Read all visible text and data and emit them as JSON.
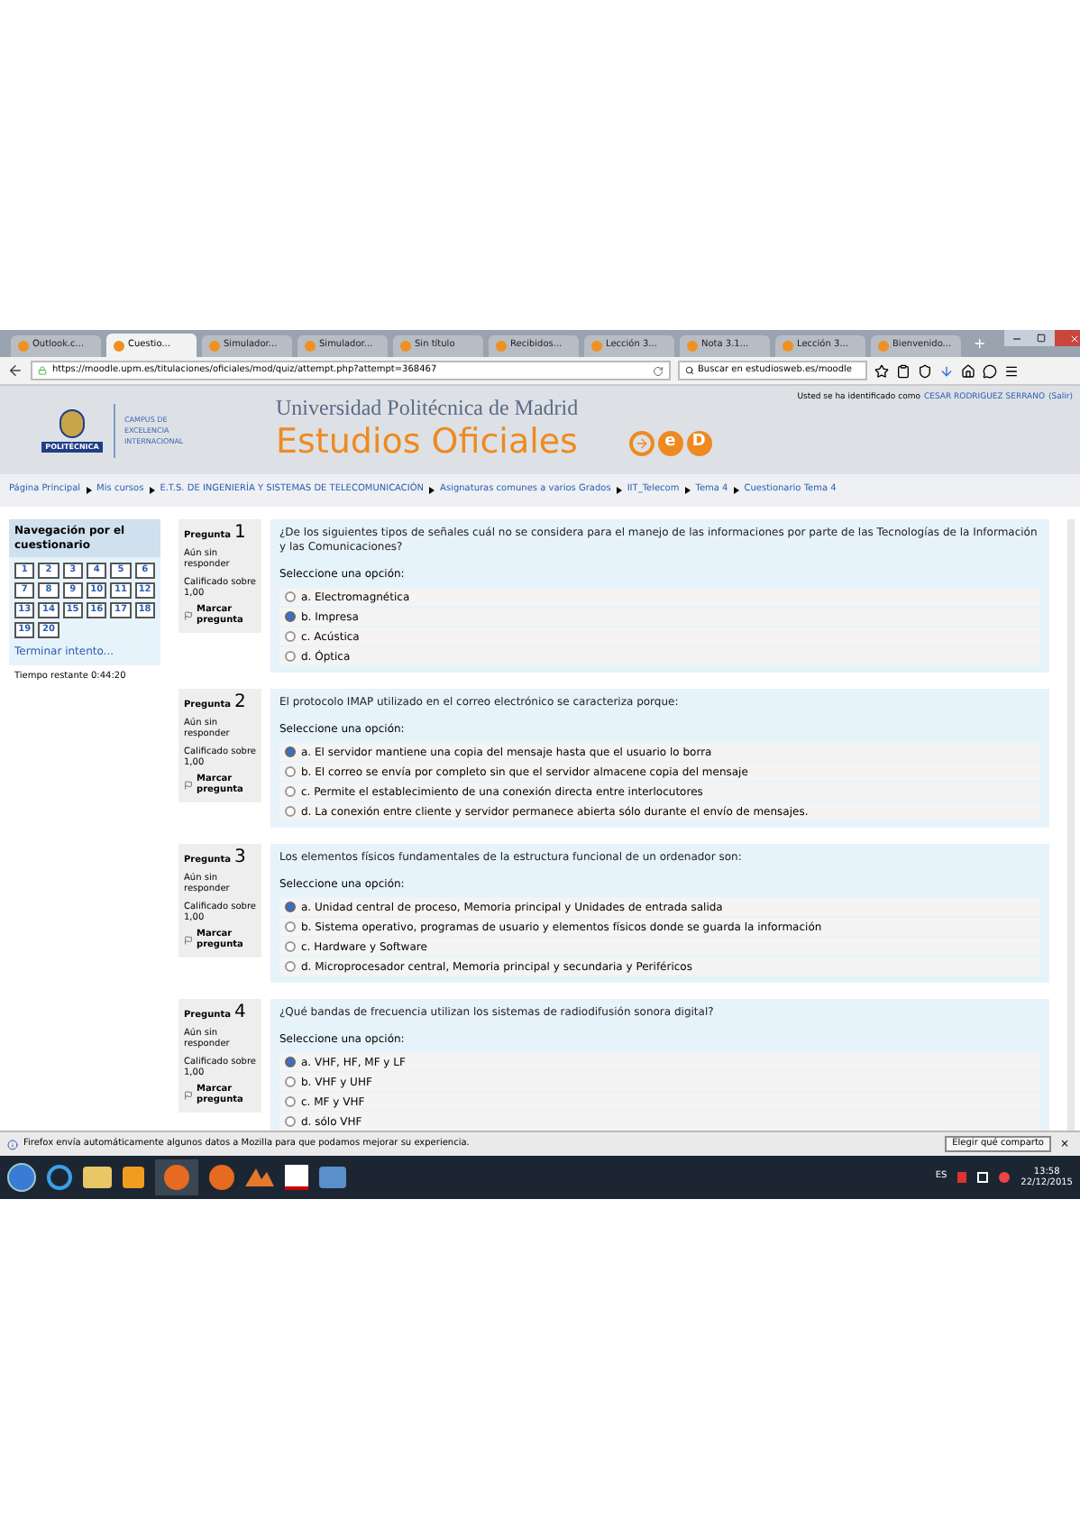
{
  "tabs": [
    {
      "label": "Outlook.c...",
      "selected": false
    },
    {
      "label": "Cuestio...",
      "selected": true
    },
    {
      "label": "Simulador...",
      "selected": false
    },
    {
      "label": "Simulador...",
      "selected": false
    },
    {
      "label": "Sin título",
      "selected": false
    },
    {
      "label": "Recibidos...",
      "selected": false
    },
    {
      "label": "Lección 3...",
      "selected": false
    },
    {
      "label": "Nota 3.1...",
      "selected": false
    },
    {
      "label": "Lección 3...",
      "selected": false
    },
    {
      "label": "Bienvenido...",
      "selected": false
    }
  ],
  "new_tab": "+",
  "address": {
    "url": "https://moodle.upm.es/titulaciones/oficiales/mod/quiz/attempt.php?attempt=368467"
  },
  "search": {
    "value": "Buscar en estudiosweb.es/moodle"
  },
  "header": {
    "crest_label": "POLITÉCNICA",
    "campus": "CAMPUS DE EXCELENCIA INTERNACIONAL",
    "university": "Universidad Politécnica de Madrid",
    "title": "Estudios Oficiales",
    "logo_letters": [
      "e",
      "D"
    ],
    "login_text": "Usted se ha identificado como",
    "user": "CESAR RODRIGUEZ SERRANO",
    "logout": "(Salir)"
  },
  "breadcrumb": [
    "Página Principal",
    "Mis cursos",
    "E.T.S. DE INGENIERÍA Y SISTEMAS DE TELECOMUNICACIÓN",
    "Asignaturas comunes a varios Grados",
    "IIT_Telecom",
    "Tema 4",
    "Cuestionario Tema 4"
  ],
  "nav": {
    "title": "Navegación por el cuestionario",
    "pages": [
      "1",
      "2",
      "3",
      "4",
      "5",
      "6",
      "7",
      "8",
      "9",
      "10",
      "11",
      "12",
      "13",
      "14",
      "15",
      "16",
      "17",
      "18",
      "19",
      "20"
    ],
    "finish": "Terminar intento...",
    "timer": "Tiempo restante 0:44:20"
  },
  "questions": [
    {
      "label": "Pregunta",
      "number": "1",
      "status": "Aún sin responder",
      "grade": "Calificado sobre 1,00",
      "flag": "Marcar pregunta",
      "text": "¿De los siguientes tipos de señales cuál no se considera para el manejo de las informaciones por parte de las Tecnologías de la Información y las Comunicaciones?",
      "prompt": "Seleccione una opción:",
      "options": [
        {
          "label": "a. Electromagnética",
          "selected": false
        },
        {
          "label": "b. Impresa",
          "selected": true
        },
        {
          "label": "c. Acústica",
          "selected": false
        },
        {
          "label": "d. Óptica",
          "selected": false
        }
      ]
    },
    {
      "label": "Pregunta",
      "number": "2",
      "status": "Aún sin responder",
      "grade": "Calificado sobre 1,00",
      "flag": "Marcar pregunta",
      "text": "El protocolo IMAP utilizado en el correo electrónico se caracteriza porque:",
      "prompt": "Seleccione una opción:",
      "options": [
        {
          "label": "a. El servidor mantiene una copia del mensaje hasta que el usuario lo borra",
          "selected": true
        },
        {
          "label": "b. El correo se envía por completo sin que el servidor almacene copia del mensaje",
          "selected": false
        },
        {
          "label": "c. Permite el establecimiento de una conexión directa entre interlocutores",
          "selected": false
        },
        {
          "label": "d. La conexión entre cliente y servidor permanece abierta sólo durante el envío de mensajes.",
          "selected": false
        }
      ]
    },
    {
      "label": "Pregunta",
      "number": "3",
      "status": "Aún sin responder",
      "grade": "Calificado sobre 1,00",
      "flag": "Marcar pregunta",
      "text": "Los elementos físicos fundamentales de la estructura funcional de un ordenador son:",
      "prompt": "Seleccione una opción:",
      "options": [
        {
          "label": "a. Unidad central de proceso, Memoria principal y Unidades de entrada salida",
          "selected": true
        },
        {
          "label": "b. Sistema operativo, programas de usuario y elementos físicos donde se guarda la información",
          "selected": false
        },
        {
          "label": "c. Hardware y Software",
          "selected": false
        },
        {
          "label": "d. Microprocesador central, Memoria principal y secundaria y Periféricos",
          "selected": false
        }
      ]
    },
    {
      "label": "Pregunta",
      "number": "4",
      "status": "Aún sin responder",
      "grade": "Calificado sobre 1,00",
      "flag": "Marcar pregunta",
      "text": "¿Qué bandas de frecuencia utilizan los sistemas de radiodifusión sonora digital?",
      "prompt": "Seleccione una opción:",
      "options": [
        {
          "label": "a. VHF, HF, MF y LF",
          "selected": true
        },
        {
          "label": "b. VHF y UHF",
          "selected": false
        },
        {
          "label": "c. MF y VHF",
          "selected": false
        },
        {
          "label": "d. sólo VHF",
          "selected": false
        }
      ]
    }
  ],
  "notification": {
    "text": "Firefox envía automáticamente algunos datos a Mozilla para que podamos mejorar su experiencia.",
    "button": "Elegir qué comparto",
    "close": "×"
  },
  "taskbar": {
    "language": "ES",
    "time": "13:58",
    "date": "22/12/2015"
  }
}
